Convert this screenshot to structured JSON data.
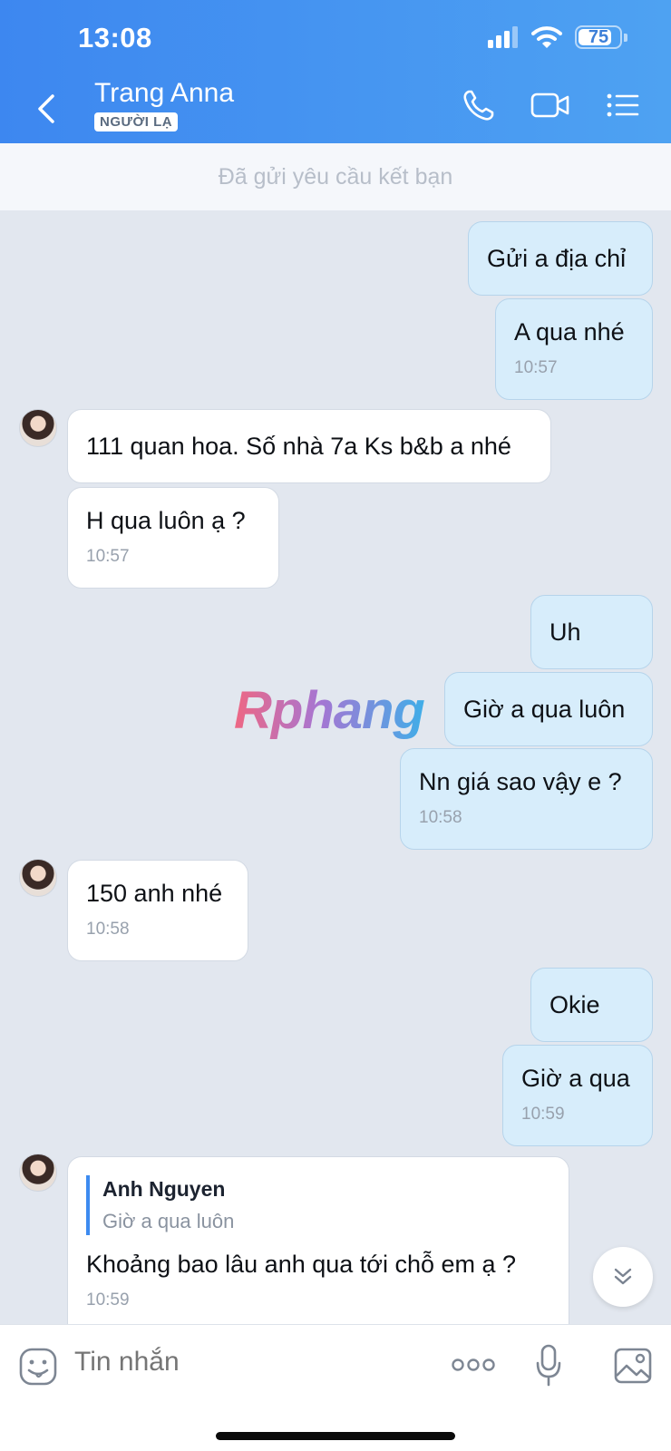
{
  "status_bar": {
    "time": "13:08",
    "battery": "75"
  },
  "header": {
    "contact_name": "Trang Anna",
    "badge": "NGƯỜI LẠ"
  },
  "friend_request": "Đã gửi yêu cầu kết bạn",
  "messages": [
    {
      "text": "Gửi a địa chỉ",
      "time": ""
    },
    {
      "text": "A qua nhé",
      "time": "10:57"
    },
    {
      "text": "111 quan hoa. Số nhà 7a Ks b&b a nhé",
      "time": ""
    },
    {
      "text": "H qua luôn ạ ?",
      "time": "10:57"
    },
    {
      "text": "Uh",
      "time": ""
    },
    {
      "text": "Giờ a qua luôn",
      "time": ""
    },
    {
      "text": "Nn giá sao vậy e ?",
      "time": "10:58"
    },
    {
      "text": "150 anh nhé",
      "time": "10:58"
    },
    {
      "text": "Okie",
      "time": ""
    },
    {
      "text": "Giờ a qua",
      "time": "10:59"
    },
    {
      "text": "Khoảng bao lâu anh qua tới chỗ em ạ ?",
      "time": "10:59",
      "quote_name": "Anh Nguyen",
      "quote_text": "Giờ a qua luôn"
    }
  ],
  "watermark": "Rphang",
  "input": {
    "placeholder": "Tin nhắn"
  },
  "colors": {
    "header_start": "#3d87f0",
    "header_end": "#4ea2f2",
    "sent_bubble": "#d7edfb",
    "recv_bubble": "#ffffff",
    "chat_bg": "#e2e7ef"
  }
}
